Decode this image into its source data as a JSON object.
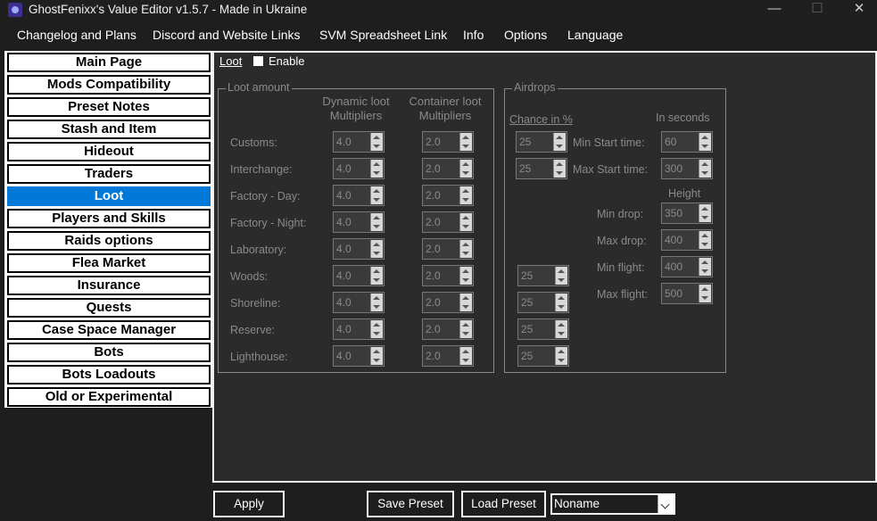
{
  "window": {
    "title": "GhostFenixx's Value Editor v1.5.7 - Made in Ukraine",
    "minimize": "—",
    "maximize": "☐",
    "close": "✕"
  },
  "menu": [
    "Changelog and Plans",
    "Discord and Website Links",
    "SVM Spreadsheet Link",
    "Info",
    "Options",
    "Language"
  ],
  "sidebar": {
    "active_index": 6,
    "items": [
      "Main Page",
      "Mods Compatibility",
      "Preset Notes",
      "Stash and Item",
      "Hideout",
      "Traders",
      "Loot",
      "Players and Skills",
      "Raids options",
      "Flea Market",
      "Insurance",
      "Quests",
      "Case Space Manager",
      "Bots",
      "Bots Loadouts",
      "Old or Experimental"
    ]
  },
  "loot": {
    "tab_label": "Loot",
    "enable_label": "Enable",
    "enabled": false,
    "amount": {
      "title": "Loot amount",
      "dynamic_header_1": "Dynamic loot",
      "dynamic_header_2": "Multipliers",
      "container_header_1": "Container loot",
      "container_header_2": "Multipliers",
      "maps": [
        {
          "name": "Customs:",
          "dynamic": "4.0",
          "container": "2.0"
        },
        {
          "name": "Interchange:",
          "dynamic": "4.0",
          "container": "2.0"
        },
        {
          "name": "Factory - Day:",
          "dynamic": "4.0",
          "container": "2.0"
        },
        {
          "name": "Factory - Night:",
          "dynamic": "4.0",
          "container": "2.0"
        },
        {
          "name": "Laboratory:",
          "dynamic": "4.0",
          "container": "2.0"
        },
        {
          "name": "Woods:",
          "dynamic": "4.0",
          "container": "2.0"
        },
        {
          "name": "Shoreline:",
          "dynamic": "4.0",
          "container": "2.0"
        },
        {
          "name": "Reserve:",
          "dynamic": "4.0",
          "container": "2.0"
        },
        {
          "name": "Lighthouse:",
          "dynamic": "4.0",
          "container": "2.0"
        }
      ]
    },
    "airdrops": {
      "title": "Airdrops",
      "chance_header": "Chance in %",
      "seconds_header": "In seconds",
      "height_header": "Height",
      "chances": [
        "25",
        "25",
        "25",
        "25",
        "25",
        "25"
      ],
      "min_start_label": "Min Start time:",
      "min_start": "60",
      "max_start_label": "Max Start time:",
      "max_start": "300",
      "min_drop_label": "Min drop:",
      "min_drop": "350",
      "max_drop_label": "Max drop:",
      "max_drop": "400",
      "min_flight_label": "Min flight:",
      "min_flight": "400",
      "max_flight_label": "Max flight:",
      "max_flight": "500"
    }
  },
  "bottom": {
    "apply": "Apply",
    "save_preset": "Save Preset",
    "load_preset": "Load Preset",
    "preset_value": "Noname"
  }
}
